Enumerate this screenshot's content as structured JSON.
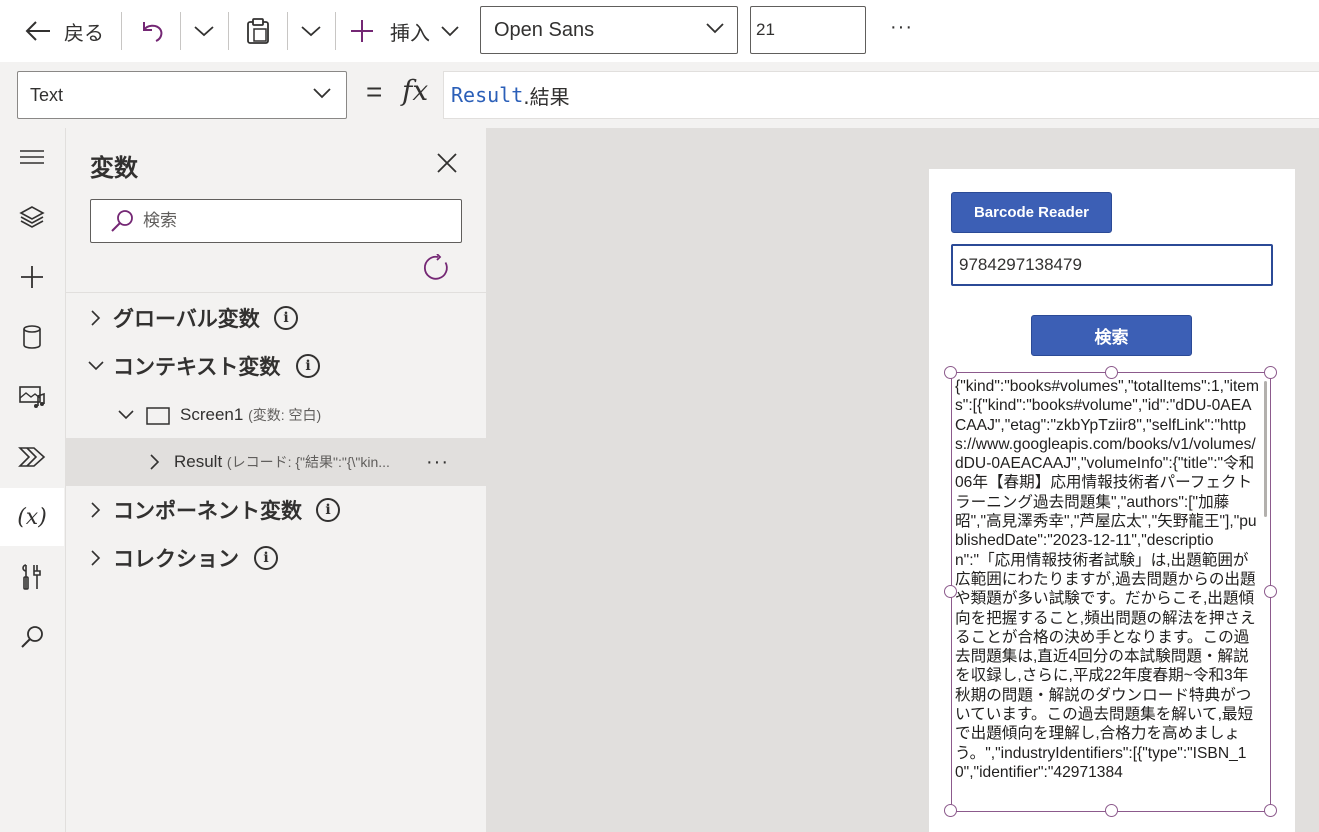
{
  "cmdbar": {
    "back_label": "戻る",
    "insert_label": "挿入",
    "font_value": "Open Sans",
    "font_size": "21",
    "more_label": "···"
  },
  "formulabar": {
    "property": "Text",
    "equals": "=",
    "fx": "fx",
    "formula_part1": "Result",
    "formula_part2": ".結果"
  },
  "rail": {
    "items": [
      "menu-icon",
      "tree-view-icon",
      "insert-icon",
      "data-icon",
      "media-icon",
      "power-automate-icon",
      "variables-icon",
      "advanced-tools-icon",
      "search-icon"
    ],
    "variables_glyph": "(x)"
  },
  "pane": {
    "title": "変数",
    "search_placeholder": "検索",
    "sections": {
      "global": "グローバル変数",
      "context": "コンテキスト変数",
      "component": "コンポーネント変数",
      "collections": "コレクション"
    },
    "screen1_name": "Screen1",
    "screen1_meta": "(変数: 空白)",
    "result_name": "Result",
    "result_meta": "(レコード: {\"結果\":\"{\\\"kin...",
    "result_more": "···",
    "info_glyph": "i"
  },
  "app": {
    "barcode_button": "Barcode Reader",
    "isbn_value": "9784297138479",
    "search_button": "検索",
    "result_text": "{\"kind\":\"books#volumes\",\"totalItems\":1,\"items\":[{\"kind\":\"books#volume\",\"id\":\"dDU-0AEACAAJ\",\"etag\":\"zkbYpTziir8\",\"selfLink\":\"https://www.googleapis.com/books/v1/volumes/dDU-0AEACAAJ\",\"volumeInfo\":{\"title\":\"令和06年【春期】応用情報技術者パーフェクトラーニング過去問題集\",\"authors\":[\"加藤昭\",\"高見澤秀幸\",\"芦屋広太\",\"矢野龍王\"],\"publishedDate\":\"2023-12-11\",\"description\":\"「応用情報技術者試験」は,出題範囲が広範囲にわたりますが,過去問題からの出題や類題が多い試験です。だからこそ,出題傾向を把握すること,頻出問題の解法を押さえることが合格の決め手となります。この過去問題集は,直近4回分の本試験問題・解説を収録し,さらに,平成22年度春期~令和3年秋期の問題・解説のダウンロード特典がついています。この過去問題集を解いて,最短で出題傾向を理解し,合格力を高めましょう。\",\"industryIdentifiers\":[{\"type\":\"ISBN_10\",\"identifier\":\"42971384"
  },
  "colors": {
    "accent": "#3c5fb5",
    "selection": "#8c5a8c",
    "formula_token": "#2b5fb8",
    "pane_bg": "#f3f2f1",
    "canvas_bg": "#e1dfdd"
  }
}
